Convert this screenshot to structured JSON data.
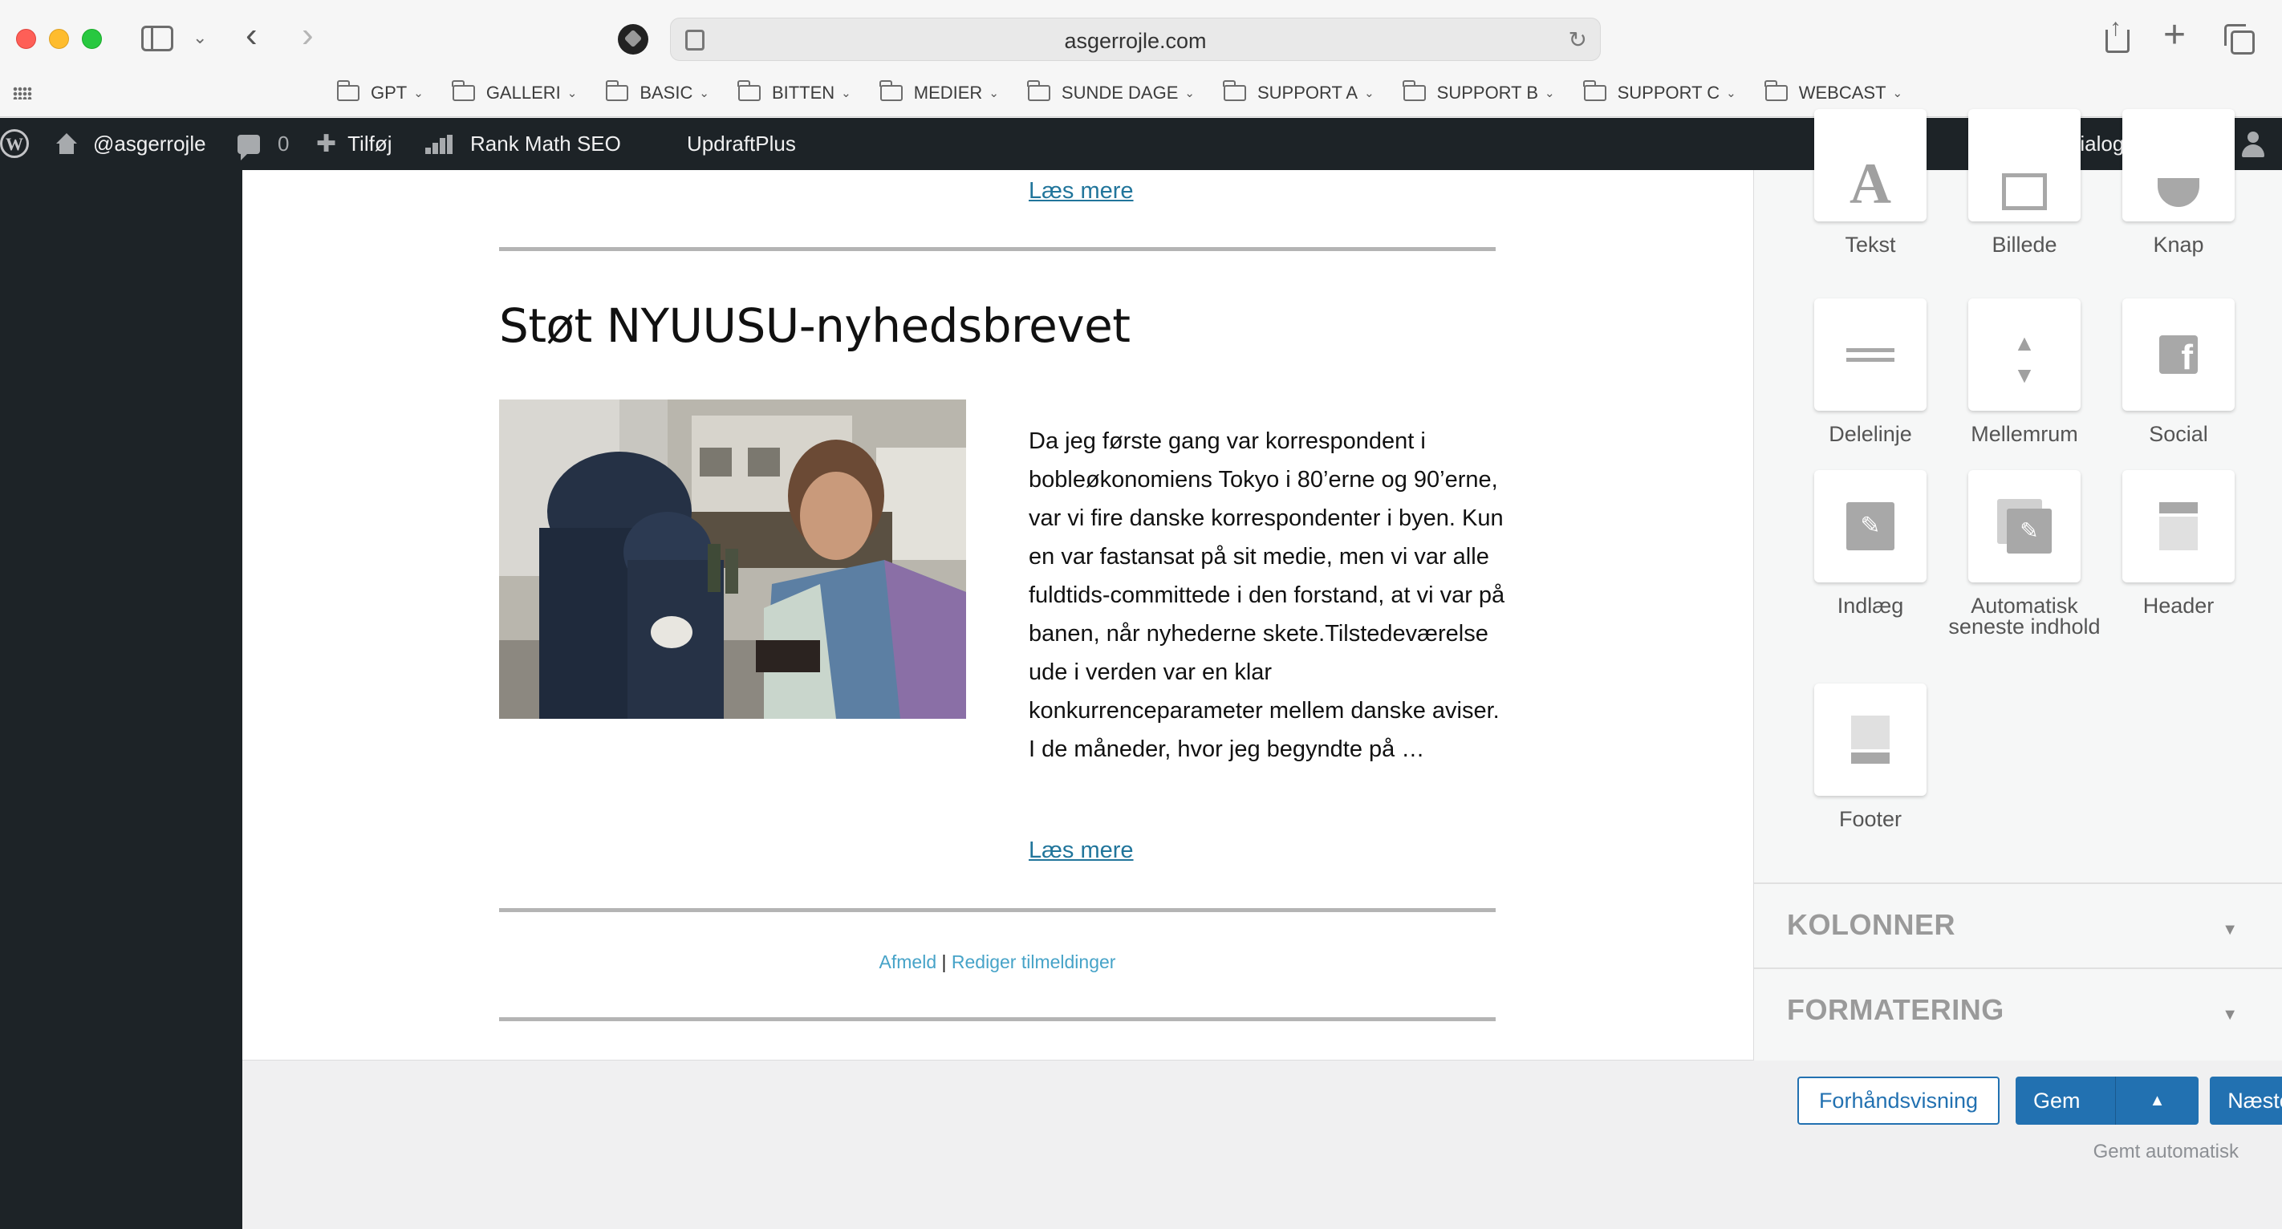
{
  "browser": {
    "url": "asgerrojle.com",
    "bookmarks": [
      {
        "label": "GPT"
      },
      {
        "label": "GALLERI"
      },
      {
        "label": "BASIC"
      },
      {
        "label": "BITTEN"
      },
      {
        "label": "MEDIER"
      },
      {
        "label": "SUNDE DAGE"
      },
      {
        "label": "SUPPORT A"
      },
      {
        "label": "SUPPORT B"
      },
      {
        "label": "SUPPORT C"
      },
      {
        "label": "WEBCAST"
      }
    ]
  },
  "adminbar": {
    "site": "@asgerrojle",
    "comments_count": "0",
    "add_new": "Tilføj",
    "rank_math": "Rank Math SEO",
    "updraft": "UpdraftPlus",
    "greeting": "Hejsa, Dialogdesigneren"
  },
  "preview": {
    "read_more_top": "Læs mere",
    "article_title": "Støt NYUUSU-nyhedsbrevet",
    "article_image_alt": "",
    "article_excerpt": "Da jeg første gang var korrespondent i bobleøkonomiens Tokyo i 80’erne og 90’erne, var vi fire danske korrespondenter i byen. Kun en var fastansat på sit medie, men vi var alle fuldtids-committede i den forstand, at vi var på banen, når nyhederne skete.Tilstedeværelse ude i verden var en klar konkurrenceparameter mellem danske aviser. I de måneder, hvor jeg begyndte på …",
    "read_more_bottom": "Læs mere",
    "footer": {
      "unsubscribe": "Afmeld",
      "separator": "|",
      "manage": "Rediger tilmeldinger"
    }
  },
  "editor_sidebar": {
    "blocks": [
      {
        "label": "Tekst",
        "icon": "text-icon"
      },
      {
        "label": "Billede",
        "icon": "image-icon"
      },
      {
        "label": "Knap",
        "icon": "button-icon"
      },
      {
        "label": "Delelinje",
        "icon": "divider-icon"
      },
      {
        "label": "Mellemrum",
        "icon": "spacer-icon"
      },
      {
        "label": "Social",
        "icon": "facebook-icon"
      },
      {
        "label": "Indlæg",
        "icon": "posts-icon"
      },
      {
        "label": "Automatisk seneste indhold",
        "icon": "auto-posts-icon"
      },
      {
        "label": "Header",
        "icon": "header-icon"
      },
      {
        "label": "Footer",
        "icon": "footer-icon"
      }
    ],
    "sections": [
      {
        "title": "KOLONNER"
      },
      {
        "title": "FORMATERING"
      }
    ]
  },
  "actions": {
    "preview": "Forhåndsvisning",
    "save": "Gem",
    "save_arrow": "▲",
    "next": "Næste",
    "autosave": "Gemt automatisk"
  },
  "colors": {
    "admin_bar": "#1d2327",
    "primary": "#2271b1",
    "link": "#21759b",
    "footer_link": "#46a3c8"
  }
}
